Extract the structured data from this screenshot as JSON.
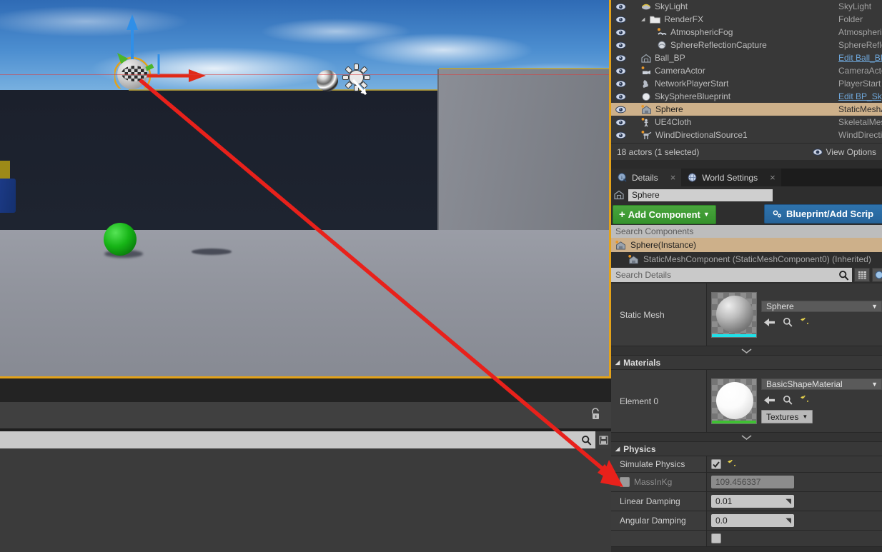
{
  "outliner": {
    "rows": [
      {
        "name": "SkyLight",
        "type": "SkyLight",
        "indent": 1,
        "icon": "skylight-icon",
        "link": false,
        "selected": false,
        "folder": false
      },
      {
        "name": "RenderFX",
        "type": "Folder",
        "indent": 1,
        "icon": "folder-icon",
        "link": false,
        "selected": false,
        "folder": true
      },
      {
        "name": "AtmosphericFog",
        "type": "AtmosphericFog",
        "indent": 2,
        "icon": "fog-icon",
        "link": false,
        "selected": false,
        "folder": false
      },
      {
        "name": "SphereReflectionCapture",
        "type": "SphereReflectionCa",
        "indent": 2,
        "icon": "reflection-icon",
        "link": false,
        "selected": false,
        "folder": false
      },
      {
        "name": "Ball_BP",
        "type": "Edit Ball_BP",
        "indent": 1,
        "icon": "blueprint-icon",
        "link": true,
        "selected": false,
        "folder": false
      },
      {
        "name": "CameraActor",
        "type": "CameraActor",
        "indent": 1,
        "icon": "camera-icon",
        "link": false,
        "selected": false,
        "folder": false
      },
      {
        "name": "NetworkPlayerStart",
        "type": "PlayerStart",
        "indent": 1,
        "icon": "playerstart-icon",
        "link": false,
        "selected": false,
        "folder": false
      },
      {
        "name": "SkySphereBlueprint",
        "type": "Edit BP_Sky_Sphe",
        "indent": 1,
        "icon": "sphere-icon",
        "link": true,
        "selected": false,
        "folder": false
      },
      {
        "name": "Sphere",
        "type": "StaticMeshActor",
        "indent": 1,
        "icon": "staticmesh-icon",
        "link": false,
        "selected": true,
        "folder": false
      },
      {
        "name": "UE4Cloth",
        "type": "SkeletalMeshActor",
        "indent": 1,
        "icon": "skeletal-icon",
        "link": false,
        "selected": false,
        "folder": false
      },
      {
        "name": "WindDirectionalSource1",
        "type": "WindDirectionalSo",
        "indent": 1,
        "icon": "wind-icon",
        "link": false,
        "selected": false,
        "folder": false
      }
    ],
    "status": "18 actors (1 selected)",
    "view_options": "View Options"
  },
  "tabs": [
    {
      "label": "Details",
      "icon": "details-icon",
      "active": true
    },
    {
      "label": "World Settings",
      "icon": "worldsettings-icon",
      "active": false
    }
  ],
  "details": {
    "actor_name": "Sphere",
    "add_component_label": "Add Component",
    "blueprint_label": "Blueprint/Add Scrip",
    "search_components_placeholder": "Search Components",
    "component_tree": [
      {
        "label": "Sphere(Instance)",
        "selected": true
      },
      {
        "label": "StaticMeshComponent (StaticMeshComponent0) (Inherited)",
        "selected": false
      }
    ],
    "search_details_placeholder": "Search Details",
    "sections": {
      "static_mesh": {
        "label": "Static Mesh",
        "asset": "Sphere",
        "thumb_bar_color": "#20e0e8"
      },
      "materials": {
        "header": "Materials",
        "element_label": "Element 0",
        "asset": "BasicShapeMaterial",
        "textures_label": "Textures",
        "thumb_bar_color": "#3fc033"
      },
      "physics": {
        "header": "Physics",
        "rows": [
          {
            "label": "Simulate Physics",
            "value": "",
            "kind": "checkbox",
            "checked": true,
            "dim": false,
            "reset": true
          },
          {
            "label": "MassInKg",
            "value": "109.456337",
            "kind": "text",
            "checked": false,
            "dim": true,
            "reset": false
          },
          {
            "label": "Linear Damping",
            "value": "0.01",
            "kind": "numeric",
            "checked": false,
            "dim": false,
            "reset": false
          },
          {
            "label": "Angular Damping",
            "value": "0.0",
            "kind": "numeric",
            "checked": false,
            "dim": false,
            "reset": false
          }
        ]
      }
    }
  },
  "viewport": {
    "lock_icon": "lock-icon",
    "search_icon": "search-icon",
    "save_icon": "save-icon",
    "search_value": ""
  },
  "colors": {
    "selection": "#cdb08a",
    "green_button": "#3a9a30",
    "blue_button": "#2b6ca5",
    "annotation_red": "#e8211b",
    "viewport_border": "#e3a21a"
  }
}
